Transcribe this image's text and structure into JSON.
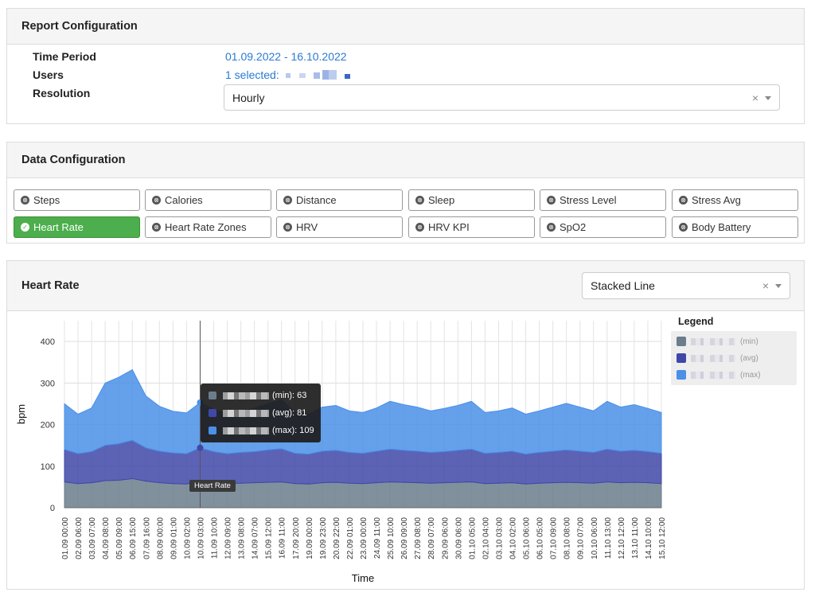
{
  "report": {
    "title": "Report Configuration",
    "time_period_label": "Time Period",
    "time_period_value": "01.09.2022 - 16.10.2022",
    "users_label": "Users",
    "users_value": "1 selected:",
    "resolution_label": "Resolution",
    "resolution_value": "Hourly",
    "clear_glyph": "×"
  },
  "data_config": {
    "title": "Data Configuration",
    "chips": [
      {
        "label": "Steps",
        "active": false
      },
      {
        "label": "Calories",
        "active": false
      },
      {
        "label": "Distance",
        "active": false
      },
      {
        "label": "Sleep",
        "active": false
      },
      {
        "label": "Stress Level",
        "active": false
      },
      {
        "label": "Stress Avg",
        "active": false
      },
      {
        "label": "Heart Rate",
        "active": true
      },
      {
        "label": "Heart Rate Zones",
        "active": false
      },
      {
        "label": "HRV",
        "active": false
      },
      {
        "label": "HRV KPI",
        "active": false
      },
      {
        "label": "SpO2",
        "active": false
      },
      {
        "label": "Body Battery",
        "active": false
      }
    ],
    "inactive_icon": "⊗",
    "active_icon": "✓"
  },
  "chart_section": {
    "title": "Heart Rate",
    "chart_type_value": "Stacked Line",
    "clear_glyph": "×",
    "legend_title": "Legend",
    "legend": [
      {
        "suffix": "(min)",
        "color": "#6b7d8c"
      },
      {
        "suffix": "(avg)",
        "color": "#3f48a8"
      },
      {
        "suffix": "(max)",
        "color": "#4a8fe8"
      }
    ],
    "tooltip": [
      {
        "text": "(min): 63",
        "color": "#6b7d8c"
      },
      {
        "text": "(avg): 81",
        "color": "#3f48a8"
      },
      {
        "text": "(max): 109",
        "color": "#4a8fe8"
      }
    ],
    "axis_tooltip": "Heart Rate"
  },
  "chart_data": {
    "type": "area",
    "stacked": true,
    "ylabel": "bpm",
    "xlabel": "Time",
    "ylim": [
      0,
      450
    ],
    "yticks": [
      0,
      100,
      200,
      300,
      400
    ],
    "grid": true,
    "legend_position": "right",
    "hover_index": 10,
    "x": [
      "01.09.2022 00:00",
      "02.09.2022 06:00",
      "03.09.2022 07:00",
      "04.09.2022 08:00",
      "05.09.2022 09:00",
      "06.09.2022 15:00",
      "07.09.2022 16:00",
      "08.09.2022 00:00",
      "09.09.2022 01:00",
      "10.09.2022 02:00",
      "10.09.2022 03:00",
      "11.09.2022 10:00",
      "12.09.2022 09:00",
      "13.09.2022 08:00",
      "14.09.2022 07:00",
      "15.09.2022 12:00",
      "16.09.2022 11:00",
      "17.09.2022 20:00",
      "19.09.2022 00:00",
      "19.09.2022 23:00",
      "20.09.2022 22:00",
      "22.09.2022 01:00",
      "23.09.2022 00:00",
      "24.09.2022 11:00",
      "25.09.2022 10:00",
      "26.09.2022 09:00",
      "27.09.2022 08:00",
      "28.09.2022 07:00",
      "29.09.2022 06:00",
      "30.09.2022 06:00",
      "01.10.2022 05:00",
      "02.10.2022 04:00",
      "03.10.2022 03:00",
      "04.10.2022 02:00",
      "05.10.2022 06:00",
      "06.10.2022 05:00",
      "07.10.2022 09:00",
      "08.10.2022 08:00",
      "09.10.2022 07:00",
      "10.10.2022 06:00",
      "11.10.2022 13:00",
      "12.10.2022 12:00",
      "13.10.2022 11:00",
      "14.10.2022 10:00",
      "15.10.2022 12:00"
    ],
    "series": [
      {
        "suffix": "(min)",
        "values": [
          62,
          58,
          60,
          65,
          66,
          70,
          64,
          60,
          58,
          57,
          63,
          60,
          58,
          59,
          60,
          61,
          62,
          58,
          57,
          60,
          61,
          59,
          58,
          60,
          62,
          61,
          60,
          59,
          60,
          61,
          62,
          58,
          59,
          60,
          57,
          59,
          60,
          61,
          60,
          59,
          62,
          60,
          61,
          60,
          58
        ]
      },
      {
        "suffix": "(avg)",
        "values": [
          78,
          72,
          75,
          85,
          88,
          92,
          80,
          76,
          74,
          73,
          81,
          75,
          72,
          74,
          75,
          78,
          80,
          73,
          72,
          76,
          77,
          74,
          73,
          76,
          79,
          77,
          76,
          74,
          75,
          77,
          79,
          73,
          74,
          76,
          72,
          74,
          76,
          78,
          76,
          74,
          79,
          76,
          77,
          75,
          73
        ]
      },
      {
        "suffix": "(max)",
        "values": [
          110,
          95,
          105,
          150,
          160,
          170,
          125,
          108,
          100,
          98,
          109,
          102,
          96,
          100,
          104,
          112,
          118,
          98,
          96,
          106,
          108,
          100,
          98,
          104,
          115,
          110,
          106,
          100,
          104,
          108,
          115,
          98,
          100,
          104,
          96,
          100,
          106,
          112,
          106,
          100,
          115,
          106,
          110,
          104,
          98
        ]
      }
    ]
  }
}
